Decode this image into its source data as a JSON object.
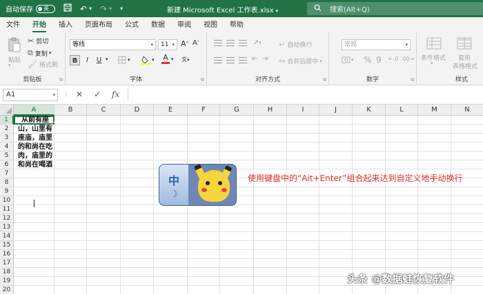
{
  "titlebar": {
    "autosave_label": "自动保存",
    "autosave_state": "关",
    "file_title": "新建 Microsoft Excel 工作表.xlsx",
    "search_placeholder": "搜索(Alt+Q)"
  },
  "menu": {
    "tabs": [
      "文件",
      "开始",
      "插入",
      "页面布局",
      "公式",
      "数据",
      "审阅",
      "视图",
      "帮助"
    ],
    "active": "开始"
  },
  "ribbon": {
    "clipboard": {
      "paste": "粘贴",
      "cut": "剪切",
      "copy": "复制",
      "format_painter": "格式刷",
      "label": "剪贴板"
    },
    "font": {
      "font_name": "等线",
      "font_size": "11",
      "bold": "B",
      "italic": "I",
      "underline": "U",
      "grow": "A",
      "shrink": "A",
      "font_color_letter": "A",
      "label": "字体"
    },
    "alignment": {
      "wrap_text": "自动换行",
      "merge_center": "合并后居中",
      "label": "对齐方式"
    },
    "number": {
      "format": "常规",
      "percent": "%",
      "comma": "9",
      "label": "数字"
    },
    "styles": {
      "conditional": "条件格式",
      "table": "套用",
      "table_line2": "表格格式",
      "label": "样式"
    }
  },
  "formula_bar": {
    "name_box": "A1",
    "cancel": "✕",
    "enter": "✓",
    "fx": "fx",
    "content": ""
  },
  "sheet": {
    "columns": [
      "A",
      "B",
      "C",
      "D",
      "E",
      "F",
      "G",
      "H",
      "I",
      "J",
      "K",
      "L",
      "M",
      "N"
    ],
    "rows": [
      "1",
      "2",
      "3",
      "4",
      "5",
      "6",
      "7",
      "8",
      "9",
      "10",
      "11",
      "12",
      "13",
      "14",
      "15",
      "16",
      "17",
      "18",
      "19",
      "20"
    ],
    "selected_cell": "A1",
    "a1_text": "从前有座\n山，山里有\n座庙，庙里\n的和尚在吃\n肉，庙里的\n和尚在喝酒"
  },
  "ime_icon": {
    "char": "中",
    "moon": "☽"
  },
  "annotation": "使用键盘中的“Ait+Enter”组合起来达到自定义地手动换行",
  "watermark": "头条 @数据蛙恢复软件",
  "colors": {
    "excel_green": "#217346",
    "annotation_red": "#e03030"
  }
}
